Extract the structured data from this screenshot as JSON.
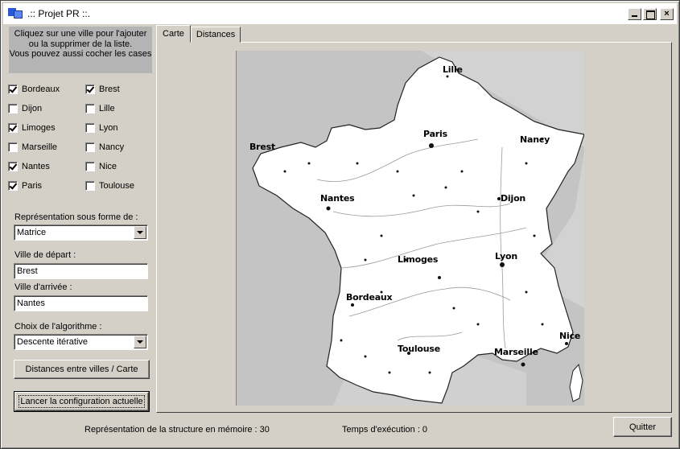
{
  "window": {
    "title": ".:: Projet PR ::.",
    "buttons": [
      "_",
      "☐",
      "×"
    ]
  },
  "instructions": {
    "line1": "Cliquez sur une ville pour l'ajouter",
    "line2": "ou la supprimer de la liste.",
    "line3": "Vous pouvez aussi cocher les cases"
  },
  "cities": [
    {
      "label": "Bordeaux",
      "checked": true
    },
    {
      "label": "Brest",
      "checked": true
    },
    {
      "label": "Dijon",
      "checked": false
    },
    {
      "label": "Lille",
      "checked": false
    },
    {
      "label": "Limoges",
      "checked": true
    },
    {
      "label": "Lyon",
      "checked": false
    },
    {
      "label": "Marseille",
      "checked": false
    },
    {
      "label": "Nancy",
      "checked": false
    },
    {
      "label": "Nantes",
      "checked": true
    },
    {
      "label": "Nice",
      "checked": false
    },
    {
      "label": "Paris",
      "checked": true
    },
    {
      "label": "Toulouse",
      "checked": false
    }
  ],
  "representation": {
    "label": "Représentation sous forme de :",
    "value": "Matrice"
  },
  "depart": {
    "label": "Ville de départ :",
    "value": "Brest"
  },
  "arrivee": {
    "label": "Ville d'arrivée :",
    "value": "Nantes"
  },
  "algorithme": {
    "label": "Choix de l'algorithme :",
    "value": "Descente itérative"
  },
  "buttons": {
    "distances": "Distances entre villes / Carte",
    "lancer": "Lancer la configuration actuelle",
    "quitter": "Quitter"
  },
  "tabs": [
    {
      "label": "Carte",
      "active": true
    },
    {
      "label": "Distances",
      "active": false
    }
  ],
  "map": {
    "labels": {
      "lille": "Lille",
      "paris": "Paris",
      "nancy": "Nancy",
      "brest": "Brest",
      "nantes": "Nantes",
      "dijon": "Dijon",
      "limoges": "Limoges",
      "lyon": "Lyon",
      "bordeaux": "Bordeaux",
      "nice": "Nice",
      "toulouse": "Toulouse",
      "marseille": "Marseille"
    }
  },
  "status": {
    "memory": "Représentation de la structure en mémoire : 30",
    "time": "Temps d'exécution : 0"
  }
}
